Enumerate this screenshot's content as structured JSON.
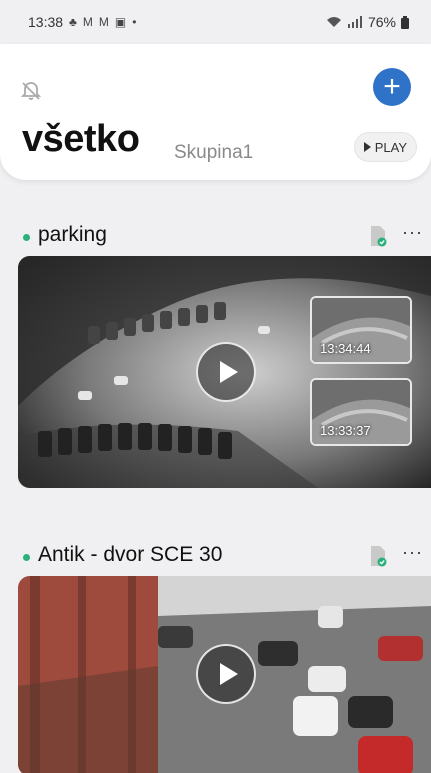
{
  "status_bar": {
    "time": "13:38",
    "notif_icons": [
      "bell-icon",
      "mail-icon",
      "mail-icon",
      "gallery-icon"
    ],
    "dot": "•",
    "battery": "76%"
  },
  "header": {
    "title": "všetko",
    "group": "Skupina1",
    "play_label": "PLAY",
    "accent_color": "#2f73c9"
  },
  "cameras": [
    {
      "name": "parking",
      "status_color": "#2ab07a",
      "thumbnails": [
        {
          "time": "13:34:44"
        },
        {
          "time": "13:33:37"
        }
      ]
    },
    {
      "name": "Antik - dvor SCE 30",
      "status_color": "#2ab07a",
      "thumbnails": []
    }
  ]
}
